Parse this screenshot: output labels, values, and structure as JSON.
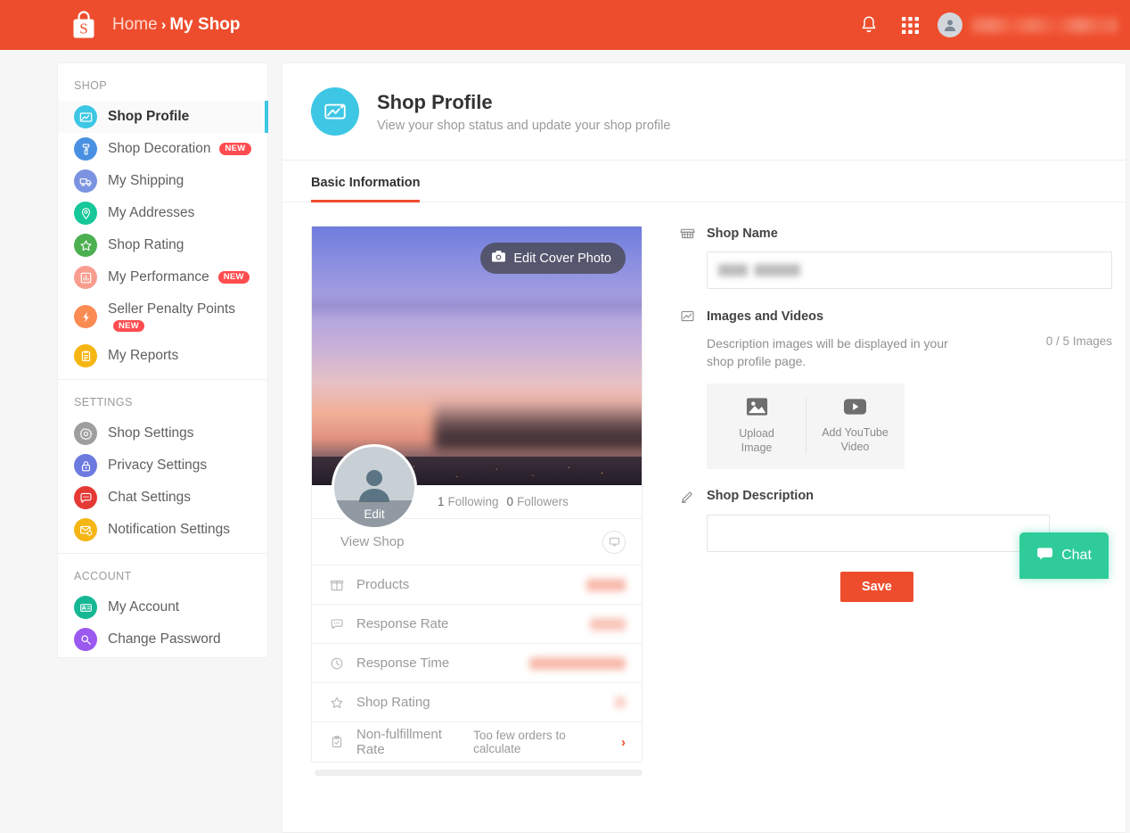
{
  "topbar": {
    "logo": "shopee-bag-logo",
    "breadcrumb_home": "Home",
    "breadcrumb_sep": "›",
    "breadcrumb_current": "My Shop",
    "bell_icon": "notification-bell-icon",
    "apps_icon": "apps-grid-icon",
    "avatar_icon": "user-avatar-icon",
    "username": "",
    "bg_color": "#ee4d2d"
  },
  "sidebar": {
    "groups": [
      {
        "title": "SHOP",
        "items": [
          {
            "label": "Shop Profile",
            "icon": "shop-profile-icon",
            "color": "#3dc7e4",
            "badge": "",
            "active": true
          },
          {
            "label": "Shop Decoration",
            "icon": "paint-roller-icon",
            "color": "#4a90e2",
            "badge": "NEW",
            "active": false
          },
          {
            "label": "My Shipping",
            "icon": "truck-icon",
            "color": "#7b93e0",
            "badge": "",
            "active": false
          },
          {
            "label": "My Addresses",
            "icon": "location-pin-icon",
            "color": "#16c79a",
            "badge": "",
            "active": false
          },
          {
            "label": "Shop Rating",
            "icon": "star-icon",
            "color": "#4caf50",
            "badge": "",
            "active": false
          },
          {
            "label": "My Performance",
            "icon": "bar-chart-icon",
            "color": "#f99d8f",
            "badge": "NEW",
            "active": false
          },
          {
            "label": "Seller Penalty Points",
            "icon": "lightning-bolt-icon",
            "color": "#f98b53",
            "badge": "NEW",
            "active": false,
            "badge_below": true
          },
          {
            "label": "My Reports",
            "icon": "clipboard-icon",
            "color": "#f5b614",
            "badge": "",
            "active": false
          }
        ]
      },
      {
        "title": "SETTINGS",
        "items": [
          {
            "label": "Shop Settings",
            "icon": "gear-icon",
            "color": "#9e9e9e",
            "badge": "",
            "active": false
          },
          {
            "label": "Privacy Settings",
            "icon": "lock-icon",
            "color": "#6c7ae0",
            "badge": "",
            "active": false
          },
          {
            "label": "Chat Settings",
            "icon": "chat-bubble-icon",
            "color": "#e53935",
            "badge": "",
            "active": false
          },
          {
            "label": "Notification Settings",
            "icon": "mail-bell-icon",
            "color": "#f5b614",
            "badge": "",
            "active": false
          }
        ]
      },
      {
        "title": "ACCOUNT",
        "items": [
          {
            "label": "My Account",
            "icon": "id-card-icon",
            "color": "#16b894",
            "badge": "",
            "active": false
          },
          {
            "label": "Change Password",
            "icon": "key-search-icon",
            "color": "#9b59f0",
            "badge": "",
            "active": false
          }
        ]
      }
    ]
  },
  "main": {
    "page_icon": "shop-profile-picture-icon",
    "title": "Shop Profile",
    "subtitle": "View your shop status and update your shop profile",
    "tab_label": "Basic Information"
  },
  "profile": {
    "edit_cover_label": "Edit Cover Photo",
    "camera_icon": "camera-icon",
    "avatar_icon": "user-avatar-icon",
    "avatar_edit_label": "Edit",
    "shop_name_redacted": "",
    "following_count": "1",
    "following_label": "Following",
    "followers_count": "0",
    "followers_label": "Followers",
    "view_shop_label": "View Shop",
    "view_shop_icon": "desktop-monitor-icon",
    "stats": [
      {
        "label": "Products",
        "icon": "products-icon",
        "value": "",
        "redacted": true
      },
      {
        "label": "Response Rate",
        "icon": "chat-bubble-icon",
        "value": "",
        "redacted": true
      },
      {
        "label": "Response Time",
        "icon": "clock-icon",
        "value": "",
        "redacted": true
      },
      {
        "label": "Shop Rating",
        "icon": "star-outline-icon",
        "value": "",
        "redacted": true
      },
      {
        "label": "Non-fulfillment Rate",
        "icon": "clipboard-check-icon",
        "value": "Too few orders to calculate",
        "redacted": false
      }
    ]
  },
  "form": {
    "shop_name": {
      "label": "Shop Name",
      "icon": "storefront-icon",
      "value": ""
    },
    "images_videos": {
      "label": "Images and Videos",
      "icon": "image-chart-icon",
      "description": "Description images will be displayed in your shop profile page.",
      "counter": "0 / 5 Images",
      "upload_image_label": "Upload\nImage",
      "upload_image_icon": "picture-icon",
      "add_video_label": "Add YouTube\nVideo",
      "add_video_icon": "youtube-play-icon"
    },
    "shop_description": {
      "label": "Shop Description",
      "icon": "pencil-icon",
      "value": ""
    },
    "save_label": "Save"
  },
  "chat": {
    "label": "Chat",
    "icon": "chat-bubble-icon",
    "color": "#2fcc9a"
  }
}
